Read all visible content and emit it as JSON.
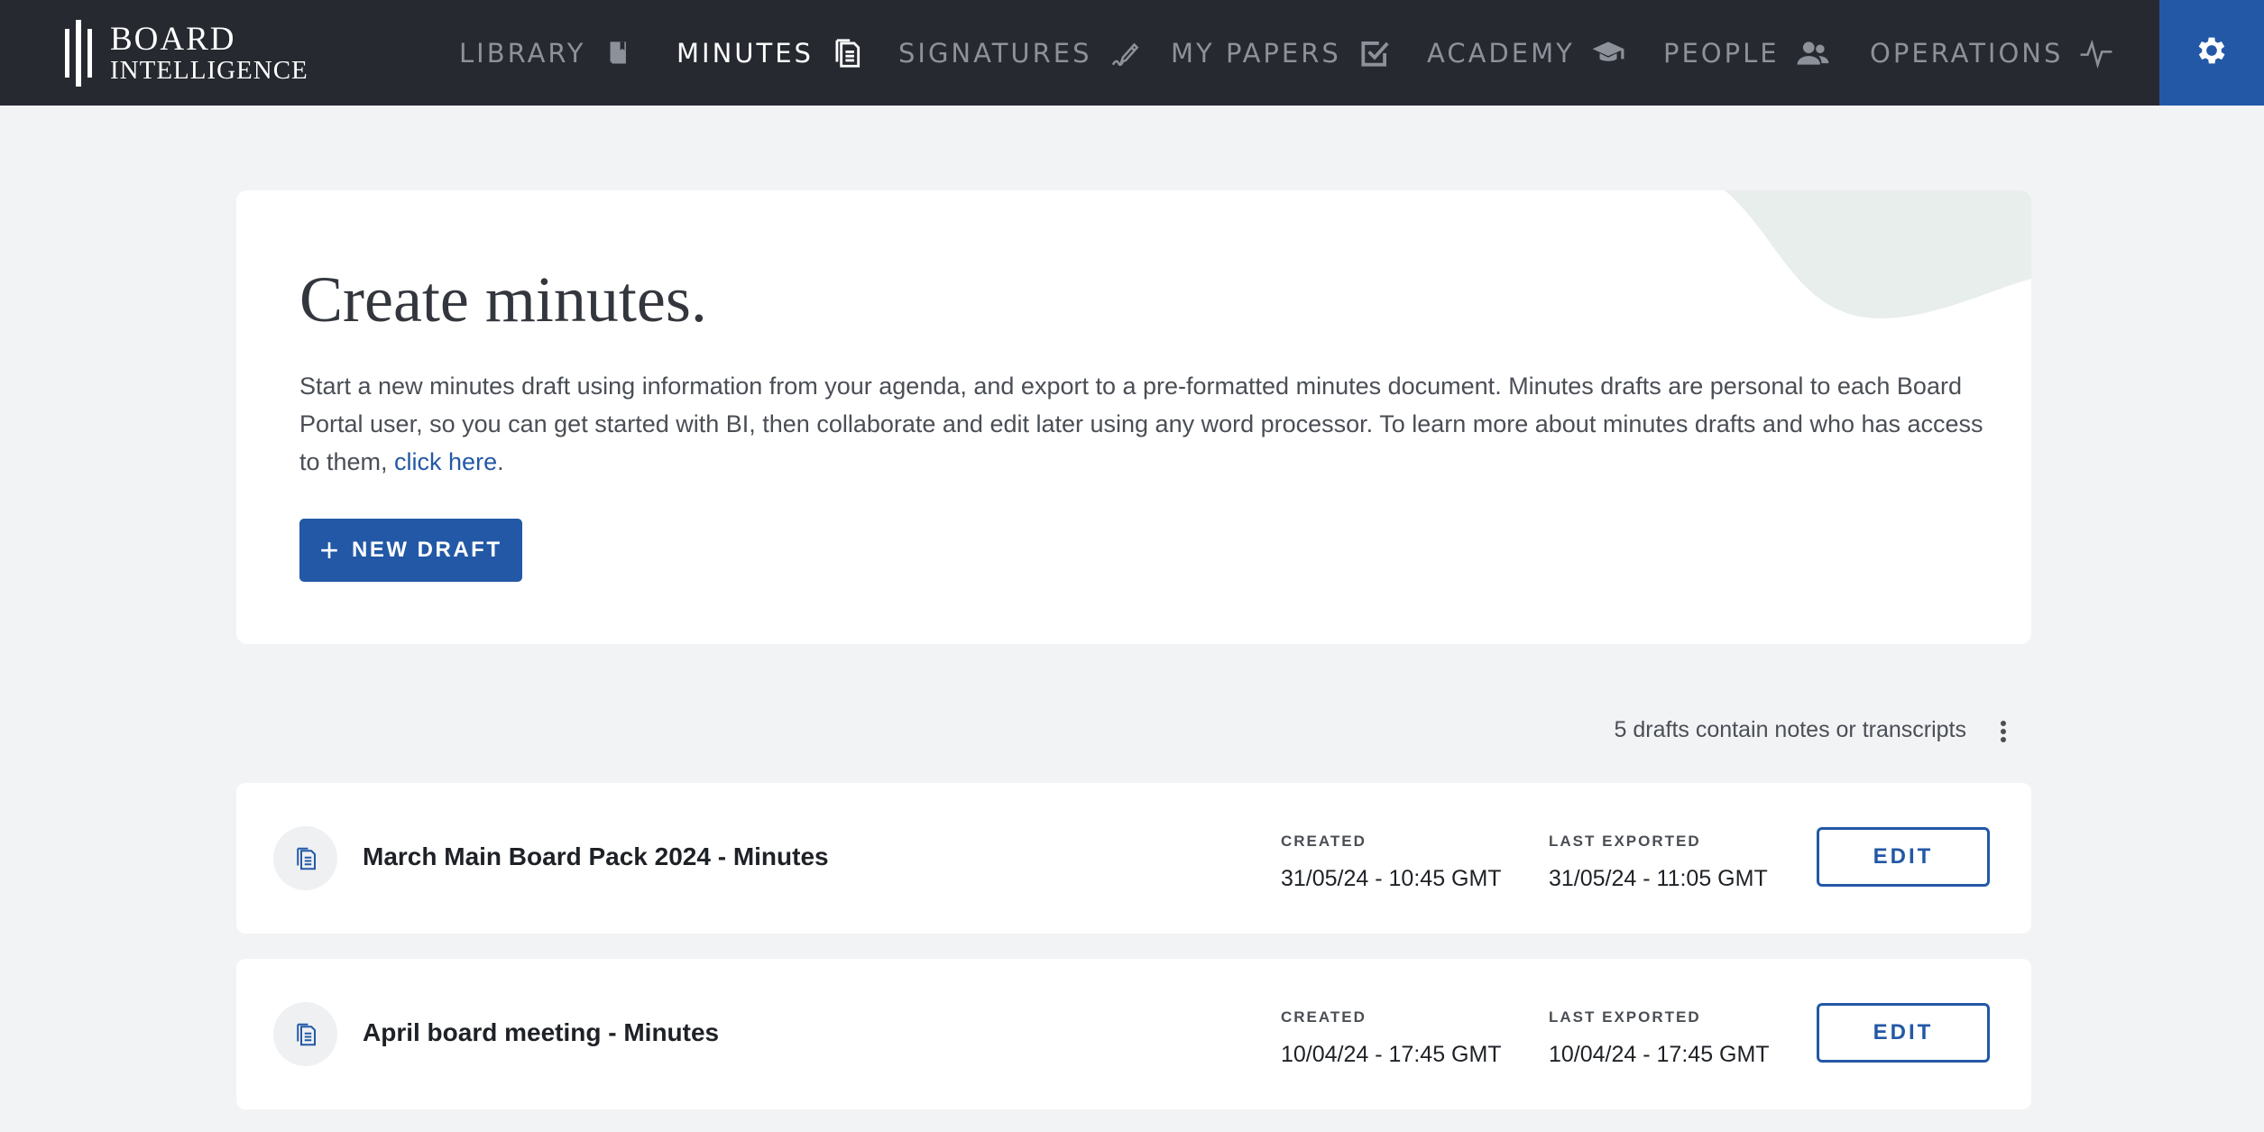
{
  "brand": {
    "line1": "BOARD",
    "line2": "INTELLIGENCE"
  },
  "nav": {
    "items": [
      {
        "label": "LIBRARY",
        "icon": "book-icon",
        "active": false
      },
      {
        "label": "MINUTES",
        "icon": "document-icon",
        "active": true
      },
      {
        "label": "SIGNATURES",
        "icon": "pen-signature-icon",
        "active": false
      },
      {
        "label": "MY PAPERS",
        "icon": "checkbox-icon",
        "active": false
      },
      {
        "label": "ACADEMY",
        "icon": "graduation-cap-icon",
        "active": false
      },
      {
        "label": "PEOPLE",
        "icon": "people-icon",
        "active": false
      },
      {
        "label": "OPERATIONS",
        "icon": "pulse-icon",
        "active": false
      }
    ],
    "settings_icon": "gear-icon"
  },
  "hero": {
    "title": "Create minutes.",
    "description": "Start a new minutes draft using information from your agenda, and export to a pre-formatted minutes document. Minutes drafts are personal to each Board Portal user, so you can get started with BI, then collaborate and edit later using any word processor. To learn more about minutes drafts and who has access to them, ",
    "link_text": "click here",
    "description_end": ".",
    "new_draft_label": "NEW DRAFT"
  },
  "drafts": {
    "info": "5 drafts contain notes or transcripts",
    "created_label": "CREATED",
    "exported_label": "LAST EXPORTED",
    "edit_label": "EDIT",
    "items": [
      {
        "title": "March Main Board Pack 2024 - Minutes",
        "created": "31/05/24 - 10:45 GMT",
        "last_exported": "31/05/24 - 11:05 GMT"
      },
      {
        "title": "April board meeting - Minutes",
        "created": "10/04/24 - 17:45 GMT",
        "last_exported": "10/04/24 - 17:45 GMT"
      }
    ]
  },
  "colors": {
    "nav_bg": "#262930",
    "accent": "#2358a6",
    "page_bg": "#f2f3f4"
  }
}
